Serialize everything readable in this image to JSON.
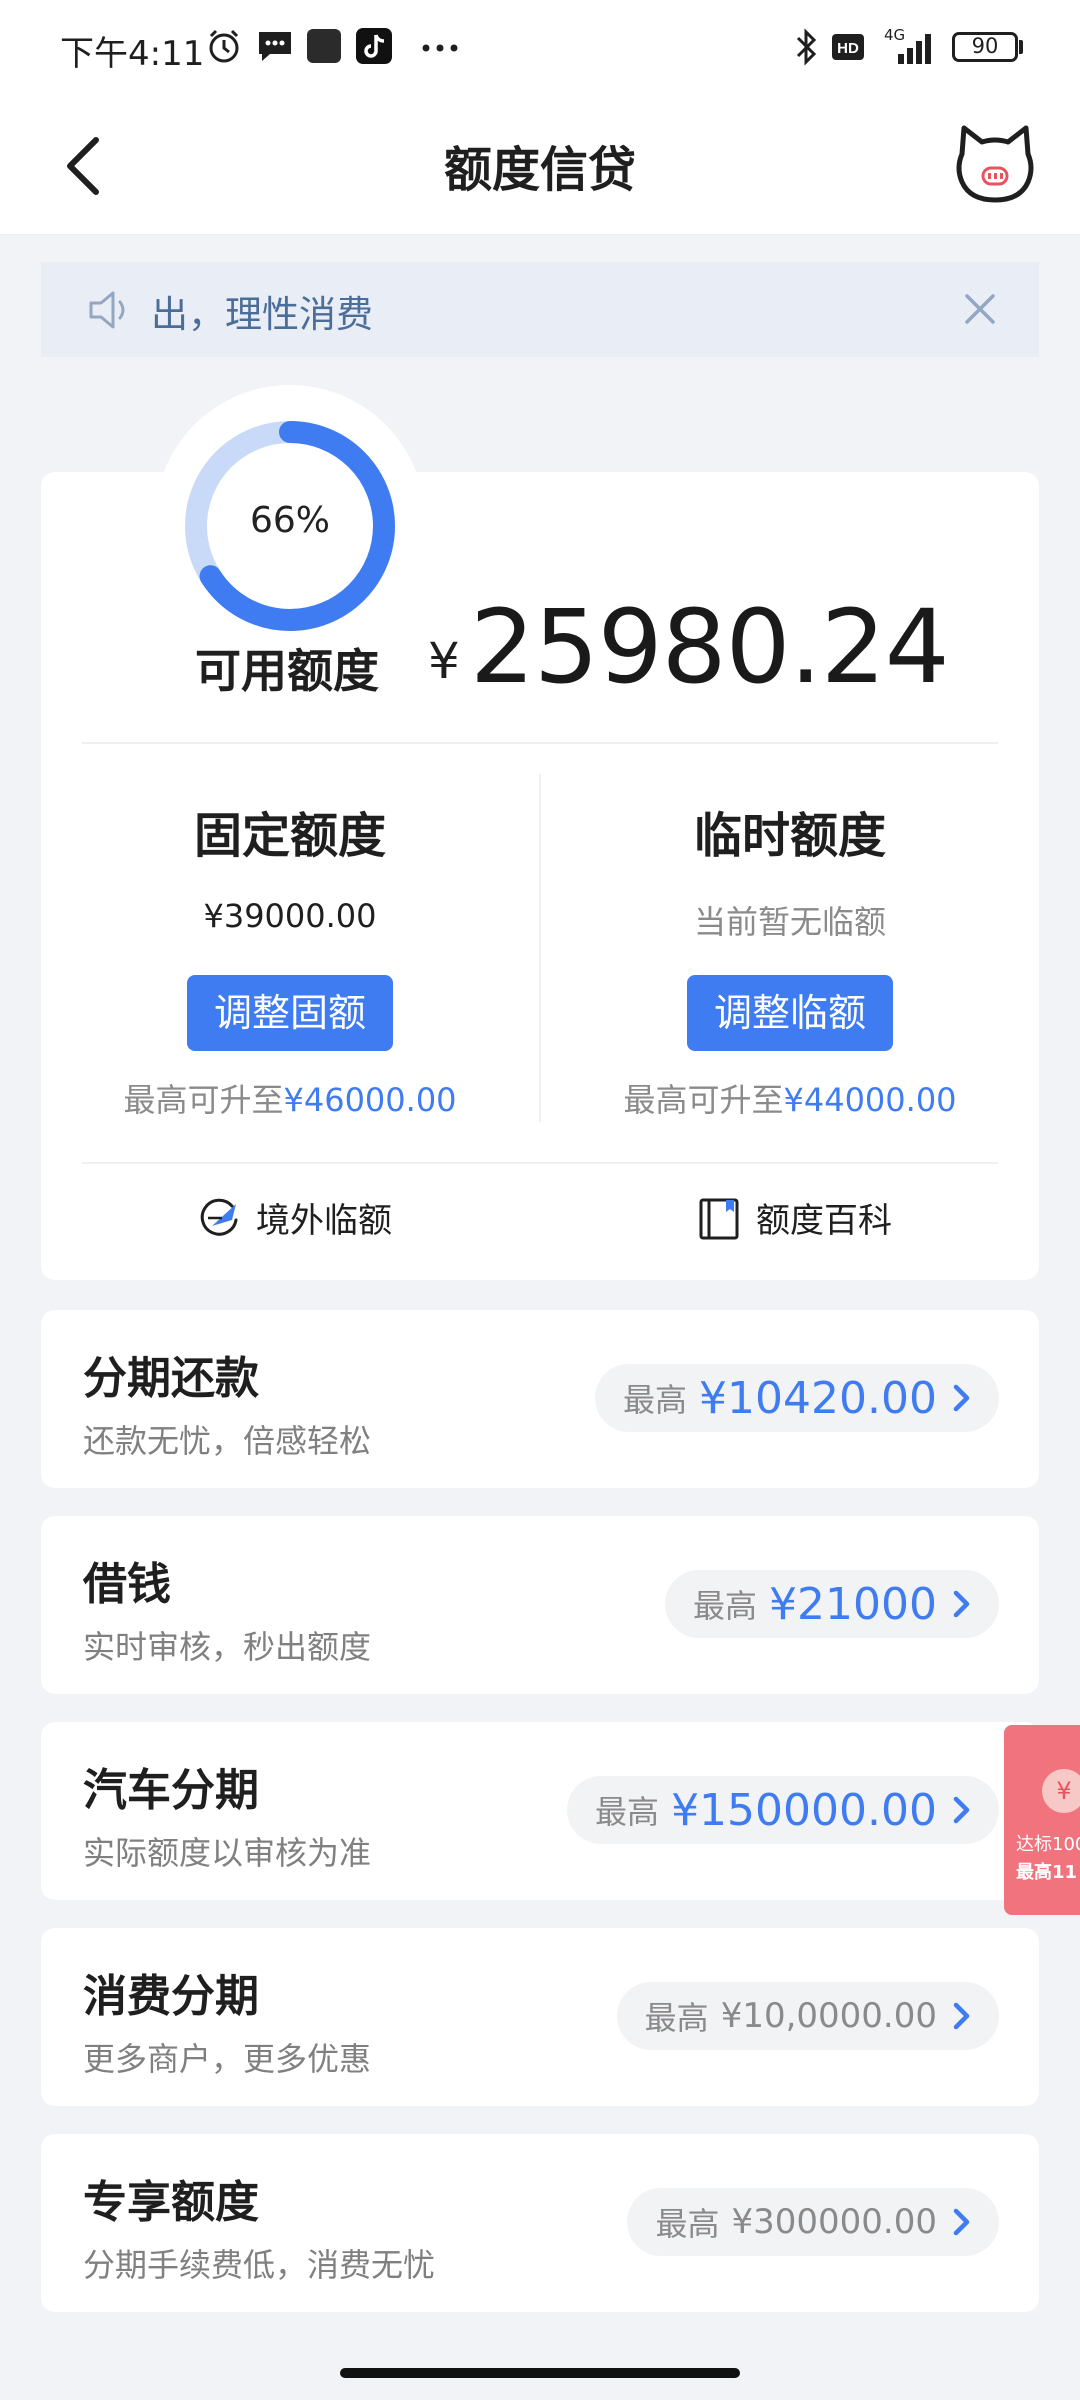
{
  "status_bar": {
    "time": "下午4:11",
    "network": "4G",
    "battery": "90",
    "icons": [
      "alarm-icon",
      "message-icon",
      "app-icon",
      "tiktok-icon",
      "more-icon",
      "bluetooth-icon",
      "hd-icon",
      "signal-icon",
      "battery-icon"
    ]
  },
  "nav": {
    "title": "额度信贷",
    "back_icon": "back-chevron-icon",
    "mascot_icon": "cat-mascot-icon"
  },
  "notice": {
    "text": "出，理性消费",
    "icon": "speaker-icon"
  },
  "credit": {
    "usage_percent": 66,
    "usage_label": "66%",
    "available_label": "可用额度",
    "currency": "¥",
    "available_amount": "25980.24",
    "fixed": {
      "title": "固定额度",
      "value": "¥39000.00",
      "button": "调整固额",
      "max_prefix": "最高可升至",
      "max_value": "¥46000.00"
    },
    "temp": {
      "title": "临时额度",
      "value": "当前暂无临额",
      "button": "调整临额",
      "max_prefix": "最高可升至",
      "max_value": "¥44000.00"
    },
    "links": [
      {
        "label": "境外临额",
        "icon": "globe-plane-icon"
      },
      {
        "label": "额度百科",
        "icon": "book-icon"
      }
    ]
  },
  "products": [
    {
      "title": "分期还款",
      "subtitle": "还款无忧，倍感轻松",
      "max_prefix": "最高",
      "max_value": "¥10420.00"
    },
    {
      "title": "借钱",
      "subtitle": "实时审核，秒出额度",
      "max_prefix": "最高",
      "max_value": "¥21000"
    },
    {
      "title": "汽车分期",
      "subtitle": "实际额度以审核为准",
      "max_prefix": "最高",
      "max_value": "¥150000.00"
    },
    {
      "title": "消费分期",
      "subtitle": "更多商户，更多优惠",
      "max_prefix": "最高",
      "max_value": "¥10,0000.00"
    },
    {
      "title": "专享额度",
      "subtitle": "分期手续费低，消费无忧",
      "max_prefix": "最高",
      "max_value": "¥300000.00"
    }
  ],
  "float_badge": {
    "coin": "¥",
    "line1": "达标100",
    "line2": "最高11"
  },
  "colors": {
    "accent": "#3F7CF2",
    "ring_track": "#C9DAF8",
    "page_bg": "#F2F3F7",
    "badge": "#F0737D"
  }
}
